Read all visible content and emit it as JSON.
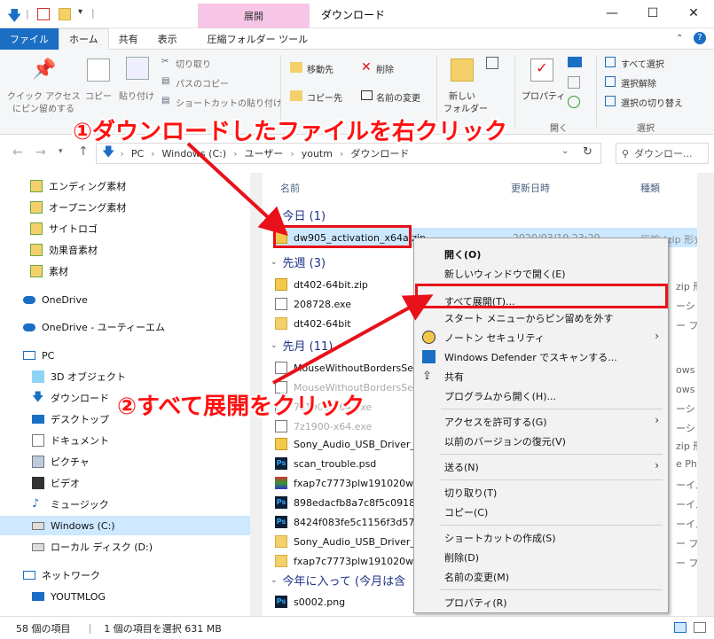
{
  "titlebar": {
    "context_tab": "展開",
    "title": "ダウンロード",
    "minimize": "—",
    "maximize": "☐",
    "close": "✕"
  },
  "tabs": [
    {
      "label": "ファイル"
    },
    {
      "label": "ホーム"
    },
    {
      "label": "共有"
    },
    {
      "label": "表示"
    },
    {
      "label": "圧縮フォルダー ツール"
    }
  ],
  "ribbon": {
    "pin": "クイック アクセス",
    "pin2": "にピン留めする",
    "copy": "コピー",
    "paste": "貼り付け",
    "cut": "切り取り",
    "copy_path": "パスのコピー",
    "paste_shortcut": "ショートカットの貼り付け",
    "move_to": "移動先",
    "copy_to": "コピー先",
    "delete": "削除",
    "rename": "名前の変更",
    "new_folder": "新しい",
    "new_folder2": "フォルダー",
    "properties": "プロパティ",
    "open_group": "開く",
    "select_all": "すべて選択",
    "select_none": "選択解除",
    "invert_select": "選択の切り替え",
    "select_group": "選択"
  },
  "nav": {
    "path": [
      "PC",
      "Windows (C:)",
      "ユーザー",
      "youtm",
      "ダウンロード"
    ],
    "search_placeholder": "ダウンロー..."
  },
  "sidebar": {
    "items": [
      {
        "label": "エンディング素材"
      },
      {
        "label": "オープニング素材"
      },
      {
        "label": "サイトロゴ"
      },
      {
        "label": "効果音素材"
      },
      {
        "label": "素材"
      },
      {
        "label": "OneDrive"
      },
      {
        "label": "OneDrive - ユーティーエム"
      },
      {
        "label": "PC"
      },
      {
        "label": "3D オブジェクト"
      },
      {
        "label": "ダウンロード"
      },
      {
        "label": "デスクトップ"
      },
      {
        "label": "ドキュメント"
      },
      {
        "label": "ピクチャ"
      },
      {
        "label": "ビデオ"
      },
      {
        "label": "ミュージック"
      },
      {
        "label": "Windows (C:)"
      },
      {
        "label": "ローカル ディスク (D:)"
      },
      {
        "label": "ネットワーク"
      },
      {
        "label": "YOUTMLOG"
      }
    ]
  },
  "columns": {
    "name": "名前",
    "date": "更新日時",
    "type": "種類"
  },
  "groups": {
    "today": "今日 (1)",
    "last_week": "先週 (3)",
    "last_month": "先月 (11)",
    "this_year": "今年に入って (今月は含"
  },
  "files": {
    "today": [
      {
        "name": "dw905_activation_x64a.zip",
        "date": "2020/03/19 23:29",
        "type": "圧縮 (zip 形式"
      }
    ],
    "last_week": [
      {
        "name": "dt402-64bit.zip",
        "right": "zip 形式"
      },
      {
        "name": "208728.exe",
        "right": "ーション"
      },
      {
        "name": "dt402-64bit",
        "right": "ー フォルダ"
      }
    ],
    "last_month": [
      {
        "name": "MouseWithoutBordersSe",
        "right": "ows イ"
      },
      {
        "name": "MouseWithoutBordersSe",
        "right": "ows イ"
      },
      {
        "name": "7z1900-x64.exe",
        "right": "ーション"
      },
      {
        "name": "7z1900-x64.exe",
        "right": "ーション"
      },
      {
        "name": "Sony_Audio_USB_Driver_",
        "right": "zip 形式"
      },
      {
        "name": "scan_trouble.psd",
        "right": "e Photo"
      },
      {
        "name": "fxap7c7773plw191020w6",
        "right": "ーイル"
      },
      {
        "name": "898edacfb8a7c8f5c09185",
        "right": "ーイル"
      },
      {
        "name": "8424f083fe5c1156f3d57e",
        "right": "ーイル"
      },
      {
        "name": "Sony_Audio_USB_Driver_",
        "right": "ー フォル"
      },
      {
        "name": "fxap7c7773plw191020w6",
        "right": "ー フォル"
      }
    ],
    "this_year": [
      {
        "name": "s0002.png",
        "right": ""
      }
    ]
  },
  "menu": [
    {
      "label": "開く(O)"
    },
    {
      "label": "新しいウィンドウで開く(E)"
    },
    {
      "label": "すべて展開(T)..."
    },
    {
      "label": "スタート メニューからピン留めを外す"
    },
    {
      "label": "ノートン セキュリティ"
    },
    {
      "label": "Windows Defender でスキャンする..."
    },
    {
      "label": "共有"
    },
    {
      "label": "プログラムから開く(H)..."
    },
    {
      "label": "アクセスを許可する(G)"
    },
    {
      "label": "以前のバージョンの復元(V)"
    },
    {
      "label": "送る(N)"
    },
    {
      "label": "切り取り(T)"
    },
    {
      "label": "コピー(C)"
    },
    {
      "label": "ショートカットの作成(S)"
    },
    {
      "label": "削除(D)"
    },
    {
      "label": "名前の変更(M)"
    },
    {
      "label": "プロパティ(R)"
    }
  ],
  "status": {
    "count": "58 個の項目",
    "selected": "1 個の項目を選択  631 MB"
  },
  "annotations": {
    "a1": "①ダウンロードしたファイルを右クリック",
    "a2": "②すべて展開をクリック"
  },
  "colors": {
    "accent": "#1a6ec3",
    "context_tab": "#f7c6e6",
    "annotation": "#ff1010",
    "selection": "#cde8ff"
  }
}
